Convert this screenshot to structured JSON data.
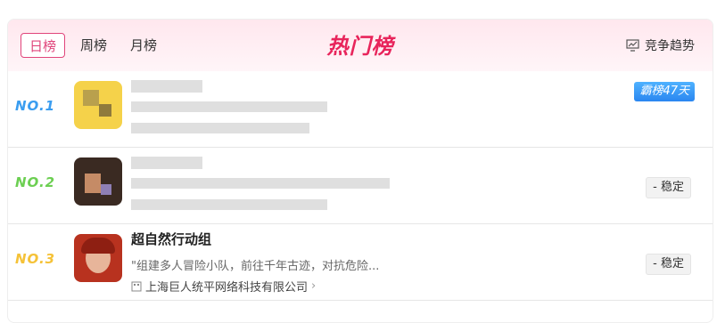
{
  "header": {
    "tabs": [
      {
        "label": "日榜",
        "active": true
      },
      {
        "label": "周榜",
        "active": false
      },
      {
        "label": "月榜",
        "active": false
      }
    ],
    "title": "热门榜",
    "trend_label": "竞争趋势",
    "trend_icon": "chart-icon"
  },
  "rows": [
    {
      "rank": "NO.1",
      "rank_color": "#3a9df0",
      "badge": "霸榜47天",
      "badge_style": "blue"
    },
    {
      "rank": "NO.2",
      "rank_color": "#6ccf52",
      "badge": "- 稳定",
      "badge_style": "gray"
    },
    {
      "rank": "NO.3",
      "rank_color": "#f5c238",
      "name": "超自然行动组",
      "description": "\"组建多人冒险小队，前往千年古迹，对抗危险...",
      "company": "上海巨人统平网络科技有限公司",
      "badge": "- 稳定",
      "badge_style": "gray"
    }
  ],
  "colors": {
    "accent": "#e0457b",
    "title": "#e8245b"
  }
}
